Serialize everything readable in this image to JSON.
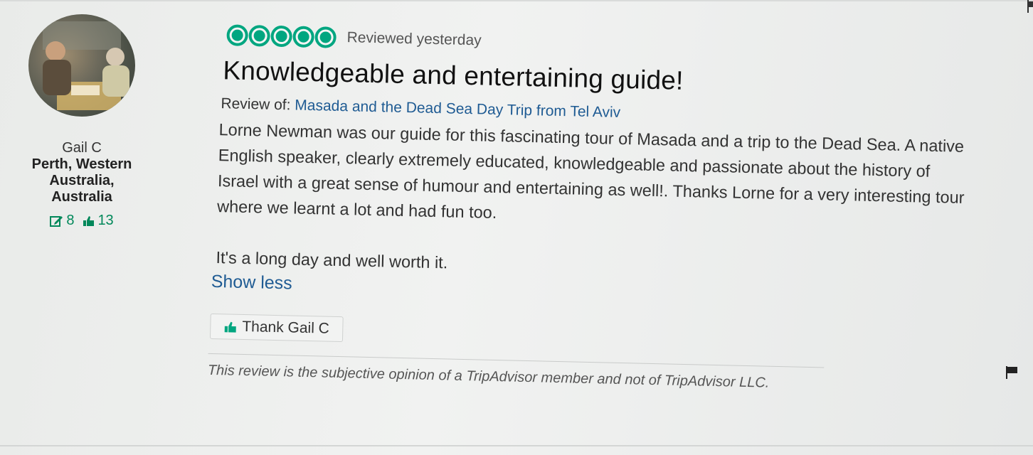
{
  "member": {
    "username": "Gail C",
    "hometown": "Perth, Western Australia, Australia",
    "review_count": "8",
    "helpful_votes": "13",
    "icons": {
      "reviews": "pencil-square-icon",
      "helpful": "thumbs-up-icon"
    }
  },
  "review": {
    "rating_bubbles": 5,
    "rating_date": "Reviewed yesterday",
    "title": "Knowledgeable and entertaining guide!",
    "review_of_label": "Review of:",
    "review_of_link": "Masada and the Dead Sea Day Trip from Tel Aviv",
    "paragraphs": [
      "Lorne Newman was our guide for this fascinating tour of Masada and a trip to the Dead Sea. A native English speaker, clearly extremely educated, knowledgeable and passionate about the history of Israel with a great sense of humour and entertaining as well!. Thanks Lorne for a very interesting tour where we learnt a lot and had fun too.",
      "It's a long day and well worth it."
    ],
    "show_less": "Show less",
    "thank_button": "Thank Gail C",
    "disclaimer": "This review is the subjective opinion of a TripAdvisor member and not of TripAdvisor LLC."
  },
  "colors": {
    "accent_green": "#00a680",
    "link_blue": "#1f5b93"
  }
}
